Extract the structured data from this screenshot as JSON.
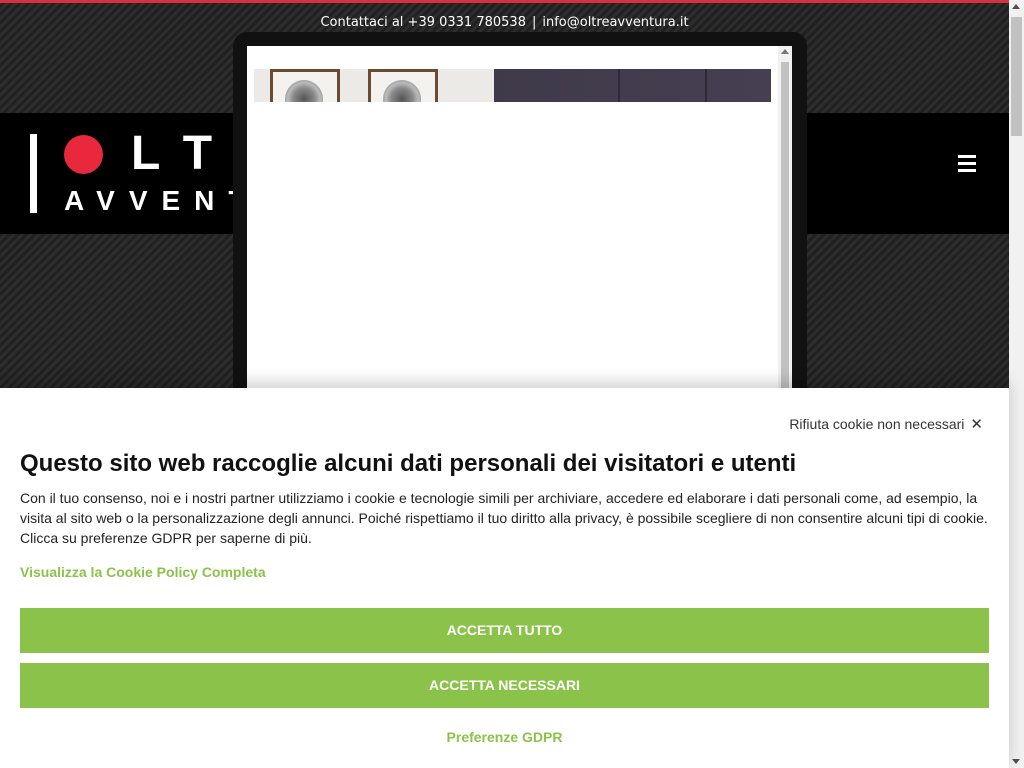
{
  "topbar": {
    "contact_label": "Contattaci al +39 0331 780538",
    "separator": "|",
    "email": "info@oltreavventura.it"
  },
  "header": {
    "logo_line1": "LT",
    "logo_line2": "AVVENT",
    "menu_icon": "hamburger-icon"
  },
  "cookie_banner": {
    "reject_label": "Rifiuta cookie non necessari",
    "reject_icon": "✕",
    "title": "Questo sito web raccoglie alcuni dati personali dei visitatori e utenti",
    "description": "Con il tuo consenso, noi e i nostri partner utilizziamo i cookie e tecnologie simili per archiviare, accedere ed elaborare i dati personali come, ad esempio, la visita al sito web o la personalizzazione degli annunci. Poiché rispettiamo il tuo diritto alla privacy, è possibile scegliere di non consentire alcuni tipi di cookie. Clicca su preferenze GDPR per saperne di più.",
    "policy_link": "Visualizza la Cookie Policy Completa",
    "accept_all": "ACCETTA TUTTO",
    "accept_necessary": "ACCETTA NECESSARI",
    "gdpr_prefs": "Preferenze GDPR"
  },
  "colors": {
    "brand_red": "#e8283b",
    "accent_green": "#8bc34a",
    "header_bg": "#000000"
  }
}
